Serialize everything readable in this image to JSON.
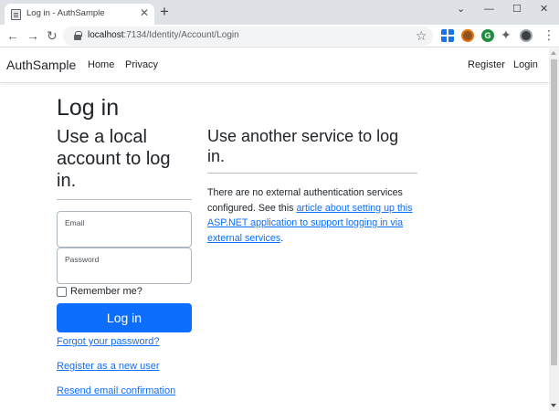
{
  "browser": {
    "tab_title": "Log in - AuthSample",
    "tab_close": "✕",
    "new_tab": "+",
    "window_controls": {
      "collapse": "⌄",
      "minimize": "—",
      "maximize": "☐",
      "close": "✕"
    },
    "nav": {
      "back": "←",
      "forward": "→",
      "reload": "↻"
    },
    "url_host": "localhost",
    "url_rest": ":7134/Identity/Account/Login",
    "bookmark_star": "☆",
    "extension_g_label": "G",
    "extensions_puzzle": "✦",
    "menu": "⋮"
  },
  "site": {
    "brand": "AuthSample",
    "nav_left": [
      "Home",
      "Privacy"
    ],
    "nav_right": [
      "Register",
      "Login"
    ]
  },
  "page": {
    "title": "Log in",
    "local_heading": "Use a local account to log in.",
    "email_label": "Email",
    "email_value": "",
    "password_label": "Password",
    "password_value": "",
    "remember_label": "Remember me?",
    "remember_checked": false,
    "login_button": "Log in",
    "forgot_link": "Forgot your password?",
    "register_link": "Register as a new user",
    "resend_link": "Resend email confirmation",
    "external_heading": "Use another service to log in.",
    "external_text_1": "There are no external authentication services configured. See this ",
    "external_link": "article about setting up this ASP.NET application to support logging in via external services",
    "external_text_2": "."
  },
  "colors": {
    "primary": "#0d6efd",
    "text": "#212529",
    "tabstrip": "#dee1e6"
  }
}
